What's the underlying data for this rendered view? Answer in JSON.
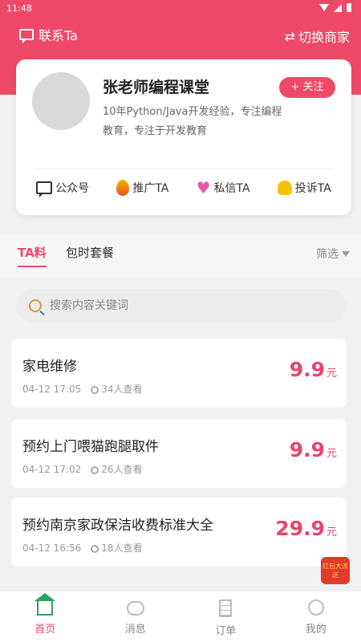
{
  "status_bar": {
    "time": "11:48"
  },
  "header": {
    "contact_label": "联系Ta",
    "switch_label": "切换商家",
    "switch_icon": "⇄"
  },
  "profile": {
    "name": "张老师编程课堂",
    "follow_label": "+ 关注",
    "description": "10年Python/Java开发经验，专注编程教育，专注于开发教育",
    "actions": [
      {
        "label": "公众号",
        "icon": "wechat-account-icon"
      },
      {
        "label": "推广TA",
        "icon": "fire-icon"
      },
      {
        "label": "私信TA",
        "icon": "heart-icon"
      },
      {
        "label": "投诉TA",
        "icon": "bell-icon"
      }
    ]
  },
  "tabs": [
    {
      "label": "TA料",
      "active": true
    },
    {
      "label": "包时套餐",
      "active": false
    }
  ],
  "filter_label": "筛选",
  "search": {
    "placeholder": "搜索内容关键词"
  },
  "items": [
    {
      "title": "家电维修",
      "time": "04-12 17:05",
      "views": "34人查看",
      "price": "9.9",
      "unit": "元"
    },
    {
      "title": "预约上门喂猫跑腿取件",
      "time": "04-12 17:02",
      "views": "26人查看",
      "price": "9.9",
      "unit": "元"
    },
    {
      "title": "预约南京家政保洁收费标准大全",
      "time": "04-12 16:56",
      "views": "18人查看",
      "price": "29.9",
      "unit": "元"
    }
  ],
  "red_envelope": {
    "text": "红包大派送"
  },
  "bottom_nav": [
    {
      "label": "首页",
      "active": true
    },
    {
      "label": "消息",
      "active": false
    },
    {
      "label": "订单",
      "active": false
    },
    {
      "label": "我的",
      "active": false
    }
  ],
  "colors": {
    "brand": "#ee4a68",
    "price": "#e8456a"
  }
}
